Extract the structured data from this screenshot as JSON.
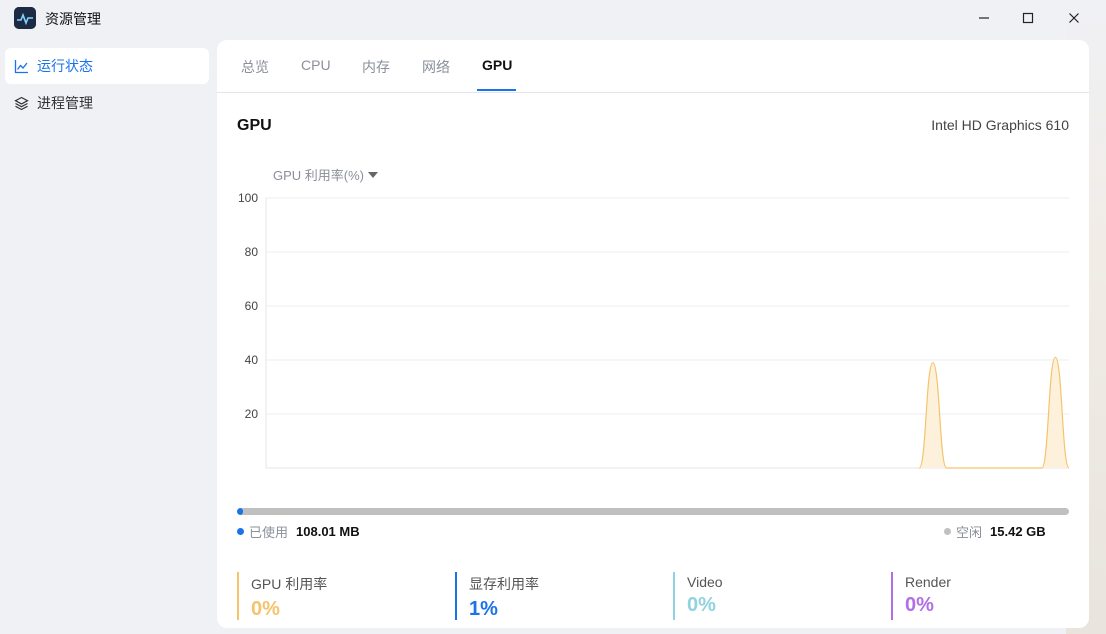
{
  "window": {
    "title": "资源管理",
    "icon": "activity-monitor-icon"
  },
  "sidebar": {
    "items": [
      {
        "label": "运行状态",
        "icon": "line-chart-icon",
        "active": true
      },
      {
        "label": "进程管理",
        "icon": "layers-icon",
        "active": false
      }
    ]
  },
  "tabs": [
    {
      "label": "总览"
    },
    {
      "label": "CPU"
    },
    {
      "label": "内存"
    },
    {
      "label": "网络"
    },
    {
      "label": "GPU",
      "active": true
    }
  ],
  "gpu": {
    "heading": "GPU",
    "model": "Intel HD Graphics 610",
    "metric_selector": "GPU 利用率(%)"
  },
  "chart_data": {
    "type": "area",
    "ylim": [
      0,
      100
    ],
    "y_ticks": [
      "100",
      "80",
      "60",
      "40",
      "20"
    ],
    "grid": true,
    "color": "#f5c36b",
    "fill": "#fdf1dc",
    "x": [
      0,
      1,
      2,
      3,
      4,
      5,
      6,
      7,
      8,
      9,
      10,
      11,
      12,
      13,
      14,
      15,
      16,
      17,
      18,
      19,
      20,
      21,
      22,
      23,
      24,
      25,
      26,
      27,
      28,
      29,
      30,
      31,
      32,
      33,
      34,
      35,
      36,
      37,
      38,
      39,
      40,
      41,
      42,
      43,
      44,
      45,
      46,
      47,
      48,
      49,
      50,
      51,
      52,
      53,
      54,
      55,
      56,
      57,
      58,
      59
    ],
    "values": [
      null,
      null,
      null,
      null,
      null,
      null,
      null,
      null,
      null,
      null,
      null,
      null,
      null,
      null,
      null,
      null,
      null,
      null,
      null,
      null,
      null,
      null,
      null,
      null,
      null,
      null,
      null,
      null,
      null,
      null,
      null,
      null,
      null,
      null,
      null,
      null,
      null,
      null,
      null,
      null,
      null,
      null,
      null,
      null,
      null,
      null,
      null,
      null,
      0,
      39,
      0,
      0,
      0,
      0,
      0,
      0,
      0,
      0,
      41,
      0
    ]
  },
  "memory": {
    "used_label": "已使用",
    "used_value": "108.01 MB",
    "free_label": "空闲",
    "free_value": "15.42 GB",
    "used_fraction": 0.007,
    "used_color": "#1a73e8",
    "free_color": "#c0c0c0"
  },
  "stats": [
    {
      "name": "GPU 利用率",
      "value": "0%",
      "color": "#f5c36b"
    },
    {
      "name": "显存利用率",
      "value": "1%",
      "color": "#1a73e8"
    },
    {
      "name": "Video",
      "value": "0%",
      "color": "#8fd3e0"
    },
    {
      "name": "Render",
      "value": "0%",
      "color": "#b26ee6"
    }
  ]
}
